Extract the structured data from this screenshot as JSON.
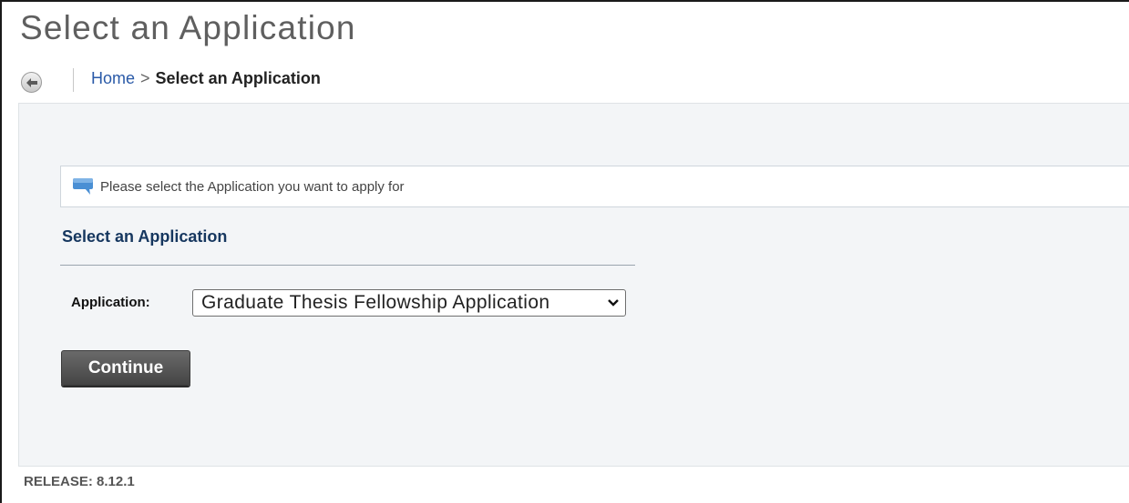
{
  "page": {
    "title": "Select an Application"
  },
  "breadcrumb": {
    "home": "Home",
    "separator": ">",
    "current": "Select an Application"
  },
  "info": {
    "icon": "speech-bubble-icon",
    "message": "Please select the Application you want to apply for"
  },
  "section": {
    "title": "Select an Application"
  },
  "form": {
    "application_label": "Application:",
    "application_selected": "Graduate Thesis Fellowship Application",
    "continue_label": "Continue"
  },
  "footer": {
    "release": "RELEASE: 8.12.1"
  },
  "colors": {
    "title_gray": "#5f5f5f",
    "link_blue": "#2a5aa8",
    "section_navy": "#16375f",
    "content_bg": "#f3f5f7",
    "button_dark": "#555555",
    "info_icon_blue": "#4a8fd4"
  }
}
